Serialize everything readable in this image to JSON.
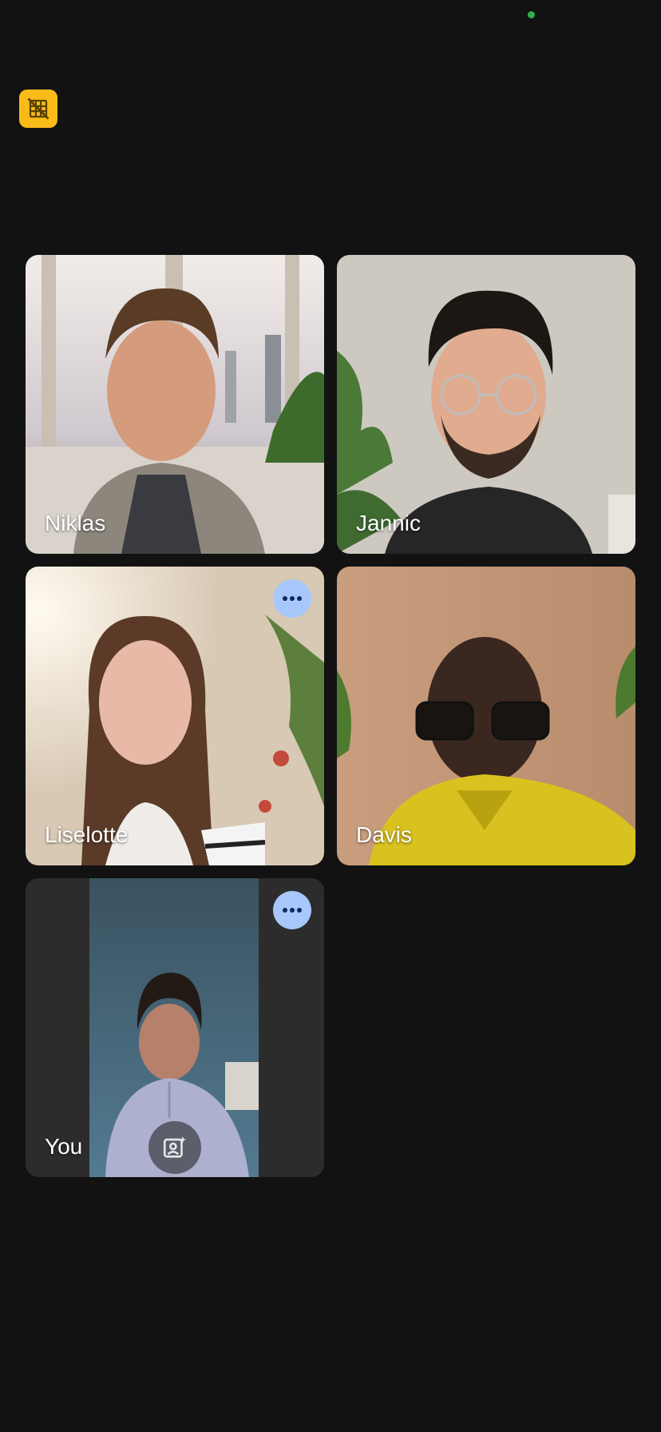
{
  "status": {
    "privacy_indicator_color": "#2fb24b"
  },
  "recording_badge": {
    "icon": "grid-off-icon",
    "color": "#f9bb17"
  },
  "participants": [
    {
      "name": "Niklas",
      "has_more_button": false
    },
    {
      "name": "Jannic",
      "has_more_button": false
    },
    {
      "name": "Liselotte",
      "has_more_button": true
    },
    {
      "name": "Davis",
      "has_more_button": true
    },
    {
      "name": "You",
      "has_more_button": true,
      "effects_icon": "portrait-sparkle-icon"
    }
  ],
  "colors": {
    "background": "#121212",
    "more_button": "#a8c7fa",
    "self_tile": "#2c2c2c"
  }
}
